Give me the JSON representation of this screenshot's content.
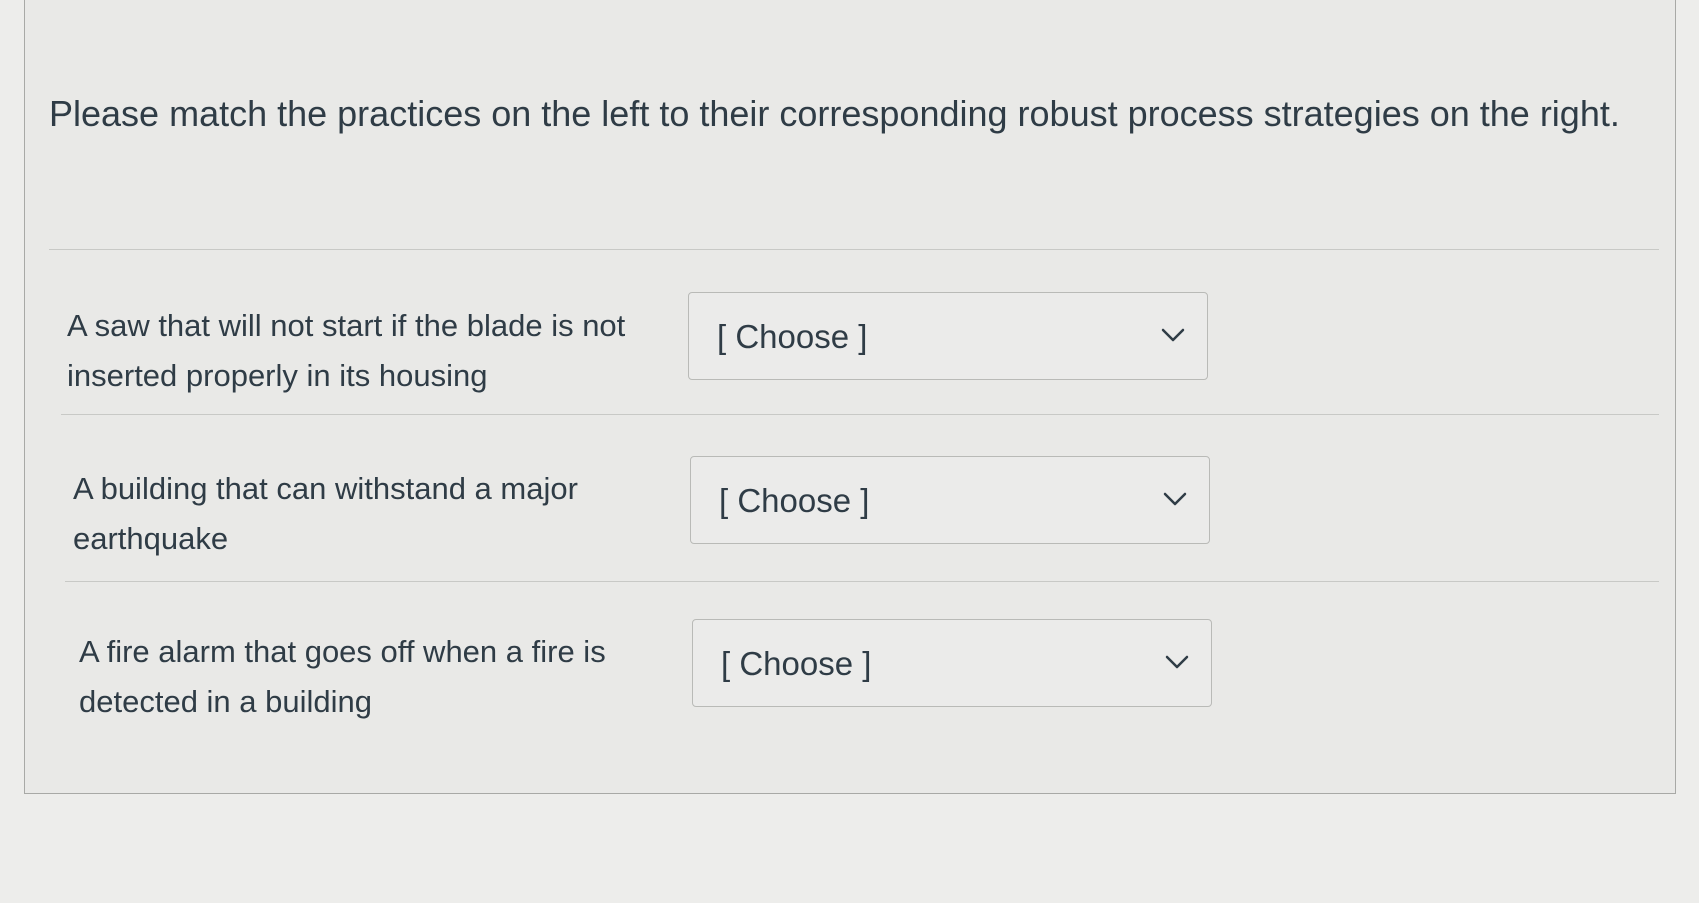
{
  "question": {
    "prompt": "Please match the practices on the left to their corresponding robust process strategies on the right."
  },
  "answers": [
    {
      "label": "A saw that will not start if the blade is not inserted properly in its housing",
      "selected": "[ Choose ]"
    },
    {
      "label": "A building that can withstand a major earthquake",
      "selected": "[ Choose ]"
    },
    {
      "label": "A fire alarm that goes off when a fire is detected in a building",
      "selected": "[ Choose ]"
    }
  ],
  "colors": {
    "background": "#ededeb",
    "card": "#e9e9e7",
    "text": "#2f3c46",
    "border": "#b9bab7"
  },
  "icons": {
    "dropdown": "chevron-down-icon"
  }
}
